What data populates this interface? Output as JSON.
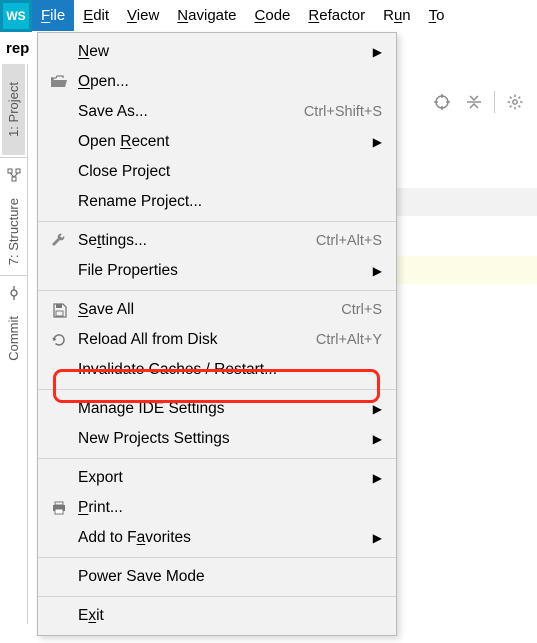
{
  "app": {
    "icon_label": "WS"
  },
  "menubar": {
    "items": [
      {
        "label": "File",
        "mnemonic": "F",
        "active": true
      },
      {
        "label": "Edit",
        "mnemonic": "E"
      },
      {
        "label": "View",
        "mnemonic": "V"
      },
      {
        "label": "Navigate",
        "mnemonic": "N"
      },
      {
        "label": "Code",
        "mnemonic": "C"
      },
      {
        "label": "Refactor",
        "mnemonic": "R"
      },
      {
        "label": "Run",
        "mnemonic": "u"
      },
      {
        "label": "Tools",
        "mnemonic": "T"
      }
    ]
  },
  "breadcrumb": {
    "text": "rep"
  },
  "gutter": {
    "labels": {
      "project": "1: Project",
      "structure": "7: Structure",
      "commit": "Commit"
    }
  },
  "menu": {
    "items": [
      {
        "label": "New",
        "mnemonic": "N",
        "submenu": true
      },
      {
        "label": "Open...",
        "mnemonic": "O",
        "icon": "folder-open-icon"
      },
      {
        "label": "Save As...",
        "shortcut": "Ctrl+Shift+S"
      },
      {
        "label": "Open Recent",
        "mnemonic": "R",
        "submenu": true
      },
      {
        "label": "Close Project"
      },
      {
        "label": "Rename Project..."
      },
      {
        "sep": true
      },
      {
        "label": "Settings...",
        "mnemonic": "t",
        "icon": "wrench-icon",
        "shortcut": "Ctrl+Alt+S"
      },
      {
        "label": "File Properties",
        "submenu": true
      },
      {
        "sep": true
      },
      {
        "label": "Save All",
        "mnemonic": "S",
        "icon": "save-icon",
        "shortcut": "Ctrl+S"
      },
      {
        "label": "Reload All from Disk",
        "icon": "reload-icon",
        "shortcut": "Ctrl+Alt+Y"
      },
      {
        "label": "Invalidate Caches / Restart...",
        "highlighted": true
      },
      {
        "sep": true
      },
      {
        "label": "Manage IDE Settings",
        "submenu": true
      },
      {
        "label": "New Projects Settings",
        "submenu": true
      },
      {
        "sep": true
      },
      {
        "label": "Export",
        "submenu": true
      },
      {
        "label": "Print...",
        "mnemonic": "P",
        "icon": "print-icon"
      },
      {
        "label": "Add to Favorites",
        "mnemonic": "a",
        "submenu": true
      },
      {
        "sep": true
      },
      {
        "label": "Power Save Mode"
      },
      {
        "sep": true
      },
      {
        "label": "Exit",
        "mnemonic": "x"
      }
    ]
  }
}
